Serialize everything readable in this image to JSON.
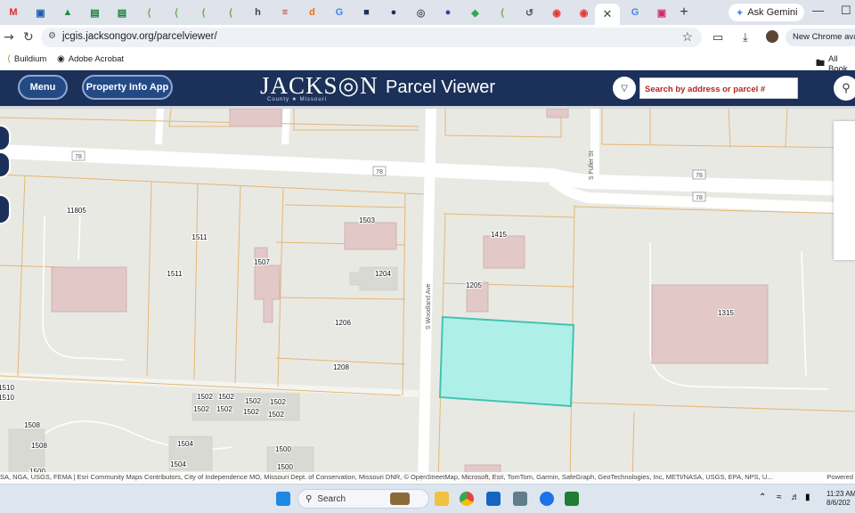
{
  "browser": {
    "tabs": [
      {
        "icon": "gmail-icon",
        "color": "#d93025",
        "letter": "M"
      },
      {
        "icon": "tab-icon",
        "color": "#1a5fb4",
        "letter": "▣"
      },
      {
        "icon": "drive-icon",
        "color": "#1e8e3e",
        "letter": "▲"
      },
      {
        "icon": "sheets-icon",
        "color": "#188038",
        "letter": "▤"
      },
      {
        "icon": "sheets-icon",
        "color": "#188038",
        "letter": "▤"
      },
      {
        "icon": "buildium-icon",
        "color": "#6aa84f",
        "letter": "⟨"
      },
      {
        "icon": "buildium-icon",
        "color": "#6aa84f",
        "letter": "⟨"
      },
      {
        "icon": "buildium-icon",
        "color": "#6aa84f",
        "letter": "⟨"
      },
      {
        "icon": "buildium-icon",
        "color": "#6aa84f",
        "letter": "⟨"
      },
      {
        "icon": "tab-icon",
        "color": "#444",
        "letter": "h"
      },
      {
        "icon": "tab-icon",
        "color": "#c62828",
        "letter": "≡"
      },
      {
        "icon": "tab-icon",
        "color": "#ef6c00",
        "letter": "d"
      },
      {
        "icon": "google-icon",
        "color": "#4285f4",
        "letter": "G"
      },
      {
        "icon": "map-icon",
        "color": "#1c3159",
        "letter": "■"
      },
      {
        "icon": "tab-icon",
        "color": "#1c3159",
        "letter": "●"
      },
      {
        "icon": "globe-icon",
        "color": "#555",
        "letter": "◎"
      },
      {
        "icon": "tab-icon",
        "color": "#303f9f",
        "letter": "●"
      },
      {
        "icon": "maps-icon",
        "color": "#34a853",
        "letter": "◆"
      },
      {
        "icon": "buildium-icon",
        "color": "#6aa84f",
        "letter": "⟨"
      },
      {
        "icon": "tab-icon",
        "color": "#555",
        "letter": "↺"
      },
      {
        "icon": "tab-icon",
        "color": "#e53935",
        "letter": "◉"
      },
      {
        "icon": "tab-icon",
        "color": "#e53935",
        "letter": "◉"
      }
    ],
    "active_tab_close": "✕",
    "after_tabs": [
      {
        "icon": "google-icon",
        "color": "#4285f4",
        "letter": "G"
      },
      {
        "icon": "instagram-icon",
        "color": "#d62976",
        "letter": "▣"
      }
    ],
    "new_tab": "+",
    "gemini_label": "Ask Gemini",
    "url": "jcgis.jacksongov.org/parcelviewer/",
    "new_chrome_label": "New Chrome availa",
    "bookmarks": [
      {
        "label": "Buildium",
        "color": "#6aa84f"
      },
      {
        "label": "Adobe Acrobat",
        "color": "#444"
      }
    ],
    "all_bookmarks": "All Book"
  },
  "app": {
    "menu_label": "Menu",
    "property_label": "Property Info App",
    "logo_text": "JACKS◎N",
    "logo_sub": "County ★ Missouri",
    "title": "Parcel Viewer",
    "search_placeholder": "Search by address or parcel #"
  },
  "map": {
    "highway_label": "78",
    "streets": [
      {
        "name": "S Woodland Ave"
      },
      {
        "name": "S Fuller St"
      }
    ],
    "parcel_labels": [
      "11805",
      "1511",
      "1511",
      "1507",
      "1503",
      "1204",
      "1206",
      "1208",
      "1415",
      "1205",
      "1315",
      "1502",
      "1502",
      "1502",
      "1502",
      "1502",
      "1502",
      "1502",
      "1502",
      "1508",
      "1508",
      "1504",
      "1504",
      "1500",
      "1500",
      "1510",
      "1510",
      "1500"
    ],
    "attribution": "SA, NGA, USGS, FEMA | Esri Community Maps Contributors, City of Independence MO, Missouri Dept. of Conservation, Missouri DNR, © OpenStreetMap, Microsoft, Esri, TomTom, Garmin, SafeGraph, GeoTechnologies, Inc, METI/NASA, USGS, EPA, NPS, U...",
    "powered": "Powered"
  },
  "taskbar": {
    "search_label": "Search",
    "time": "11:23 AM",
    "date": "8/6/202"
  }
}
